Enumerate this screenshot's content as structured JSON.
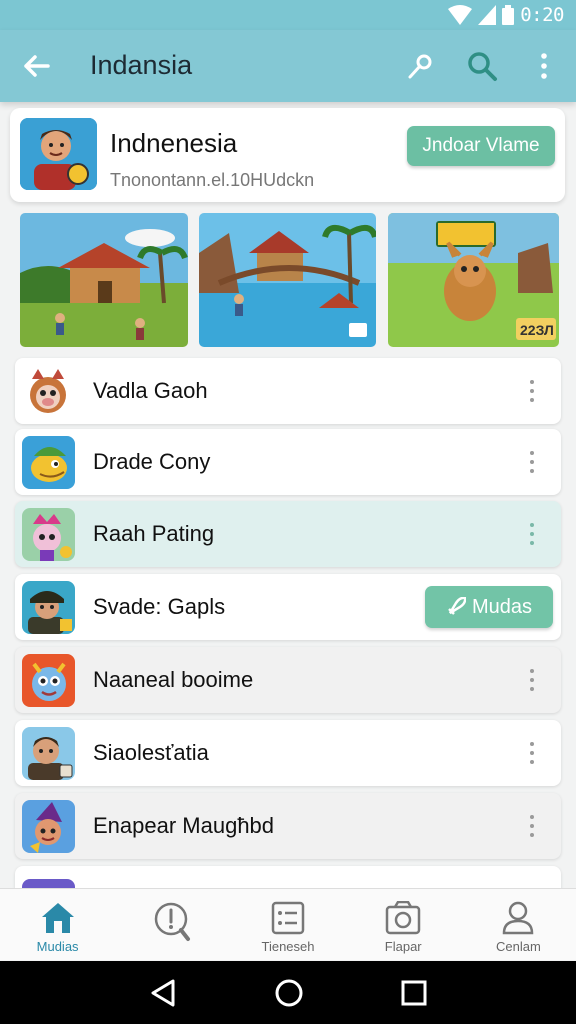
{
  "status_bar": {
    "time": "0:20"
  },
  "app_bar": {
    "title": "Indansia"
  },
  "header_card": {
    "name": "Indnenesia",
    "subtitle": "Tnonontann.el.10HUdckn",
    "cta_label": "Jndoar Vlame"
  },
  "banners": {
    "badge_text": "22ЗЛ"
  },
  "list": [
    {
      "label": "Vadla Gaoh",
      "icon": "pig-character-icon"
    },
    {
      "label": "Drade Cony",
      "icon": "lizard-character-icon"
    },
    {
      "label": "Raah Pating",
      "icon": "princess-character-icon"
    },
    {
      "label": "Svade: Gapls",
      "icon": "pirate-character-icon",
      "button_label": "Mudas"
    },
    {
      "label": "Naaneal booime",
      "icon": "monster-character-icon"
    },
    {
      "label": "Siaolesťatia",
      "icon": "man-character-icon"
    },
    {
      "label": "Enapear Maugħbd",
      "icon": "witch-character-icon"
    }
  ],
  "bottom_nav": [
    {
      "label": "Mudias",
      "icon": "home-icon",
      "active": true
    },
    {
      "label": "",
      "icon": "search-info-icon",
      "active": false
    },
    {
      "label": "Tieneseh",
      "icon": "list-icon",
      "active": false
    },
    {
      "label": "Flapar",
      "icon": "camera-icon",
      "active": false
    },
    {
      "label": "Cenlam",
      "icon": "profile-icon",
      "active": false
    }
  ],
  "colors": {
    "accent": "#84c8d4",
    "button_green": "#6cbfa3",
    "active_row": "#dff0ee"
  }
}
